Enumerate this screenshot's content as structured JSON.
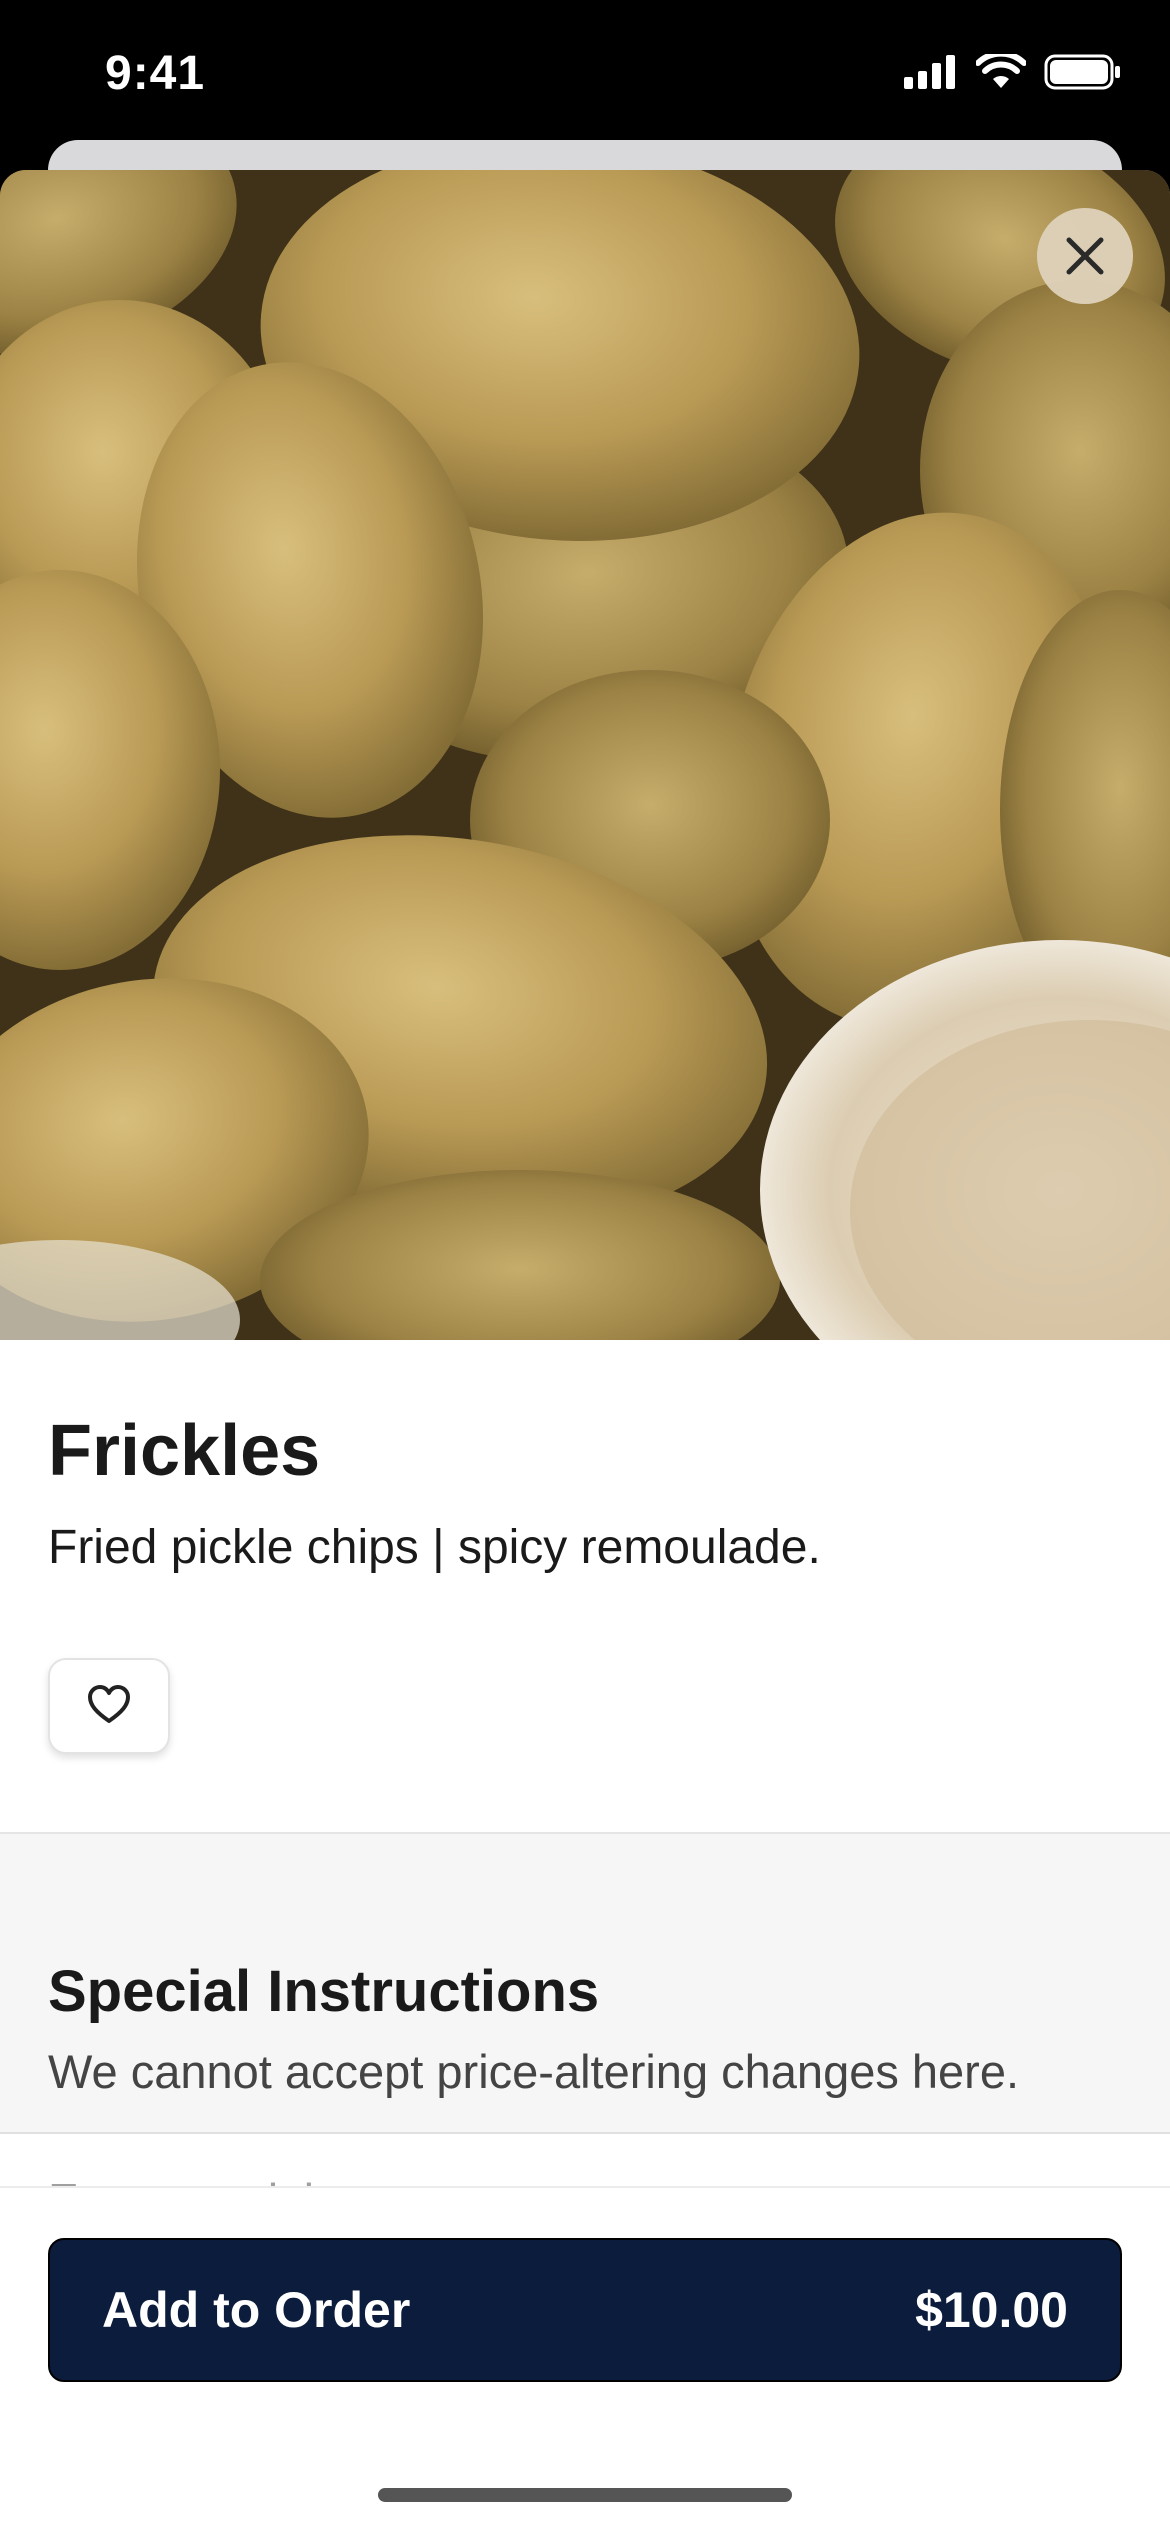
{
  "status_bar": {
    "time": "9:41",
    "icons": [
      "cellular-signal-icon",
      "wifi-icon",
      "battery-icon"
    ]
  },
  "item": {
    "name": "Frickles",
    "description": "Fried pickle chips | spicy remoulade.",
    "image_alt": "Fried pickle chips with spicy remoulade"
  },
  "actions": {
    "close_icon": "close-icon",
    "favorite_icon": "heart-icon"
  },
  "special_instructions": {
    "title": "Special Instructions",
    "subtitle": "We cannot accept price-altering changes here.",
    "input_value": "",
    "placeholder": "Enter special requests"
  },
  "order": {
    "add_label": "Add to Order",
    "price": "$10.00"
  },
  "colors": {
    "primary_button": "#0c1c3c",
    "section_background": "#f6f6f6",
    "text": "#1a1a1a"
  }
}
